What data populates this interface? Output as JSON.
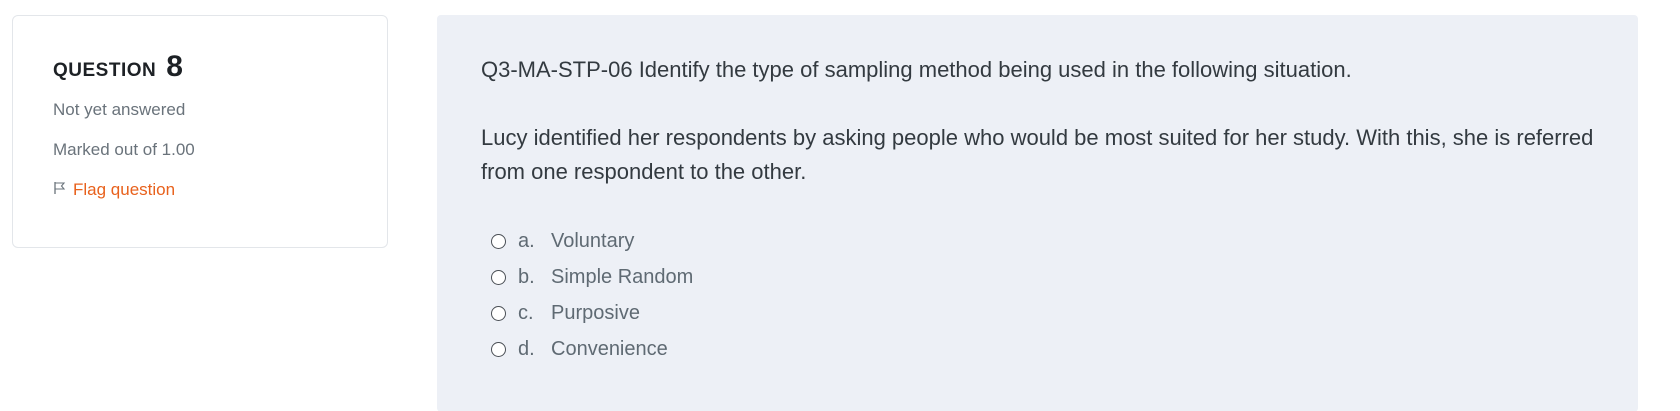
{
  "info": {
    "question_word": "QUESTION",
    "question_number": "8",
    "status": "Not yet answered",
    "marks": "Marked out of 1.00",
    "flag_label": "Flag question",
    "flag_icon": "flag-outline-icon",
    "flag_color": "#e8611c"
  },
  "question": {
    "prompt": "Q3-MA-STP-06 Identify the type of sampling method being used in the following situation.",
    "scenario": "Lucy identified her respondents by asking people who would be most suited for her study. With this, she is referred from one respondent to the other."
  },
  "answers": [
    {
      "letter": "a.",
      "text": "Voluntary"
    },
    {
      "letter": "b.",
      "text": "Simple Random"
    },
    {
      "letter": "c.",
      "text": "Purposive"
    },
    {
      "letter": "d.",
      "text": "Convenience"
    }
  ],
  "colors": {
    "content_bg": "#edf0f6",
    "card_border": "#e3e6ea",
    "muted_text": "#6a737b"
  }
}
